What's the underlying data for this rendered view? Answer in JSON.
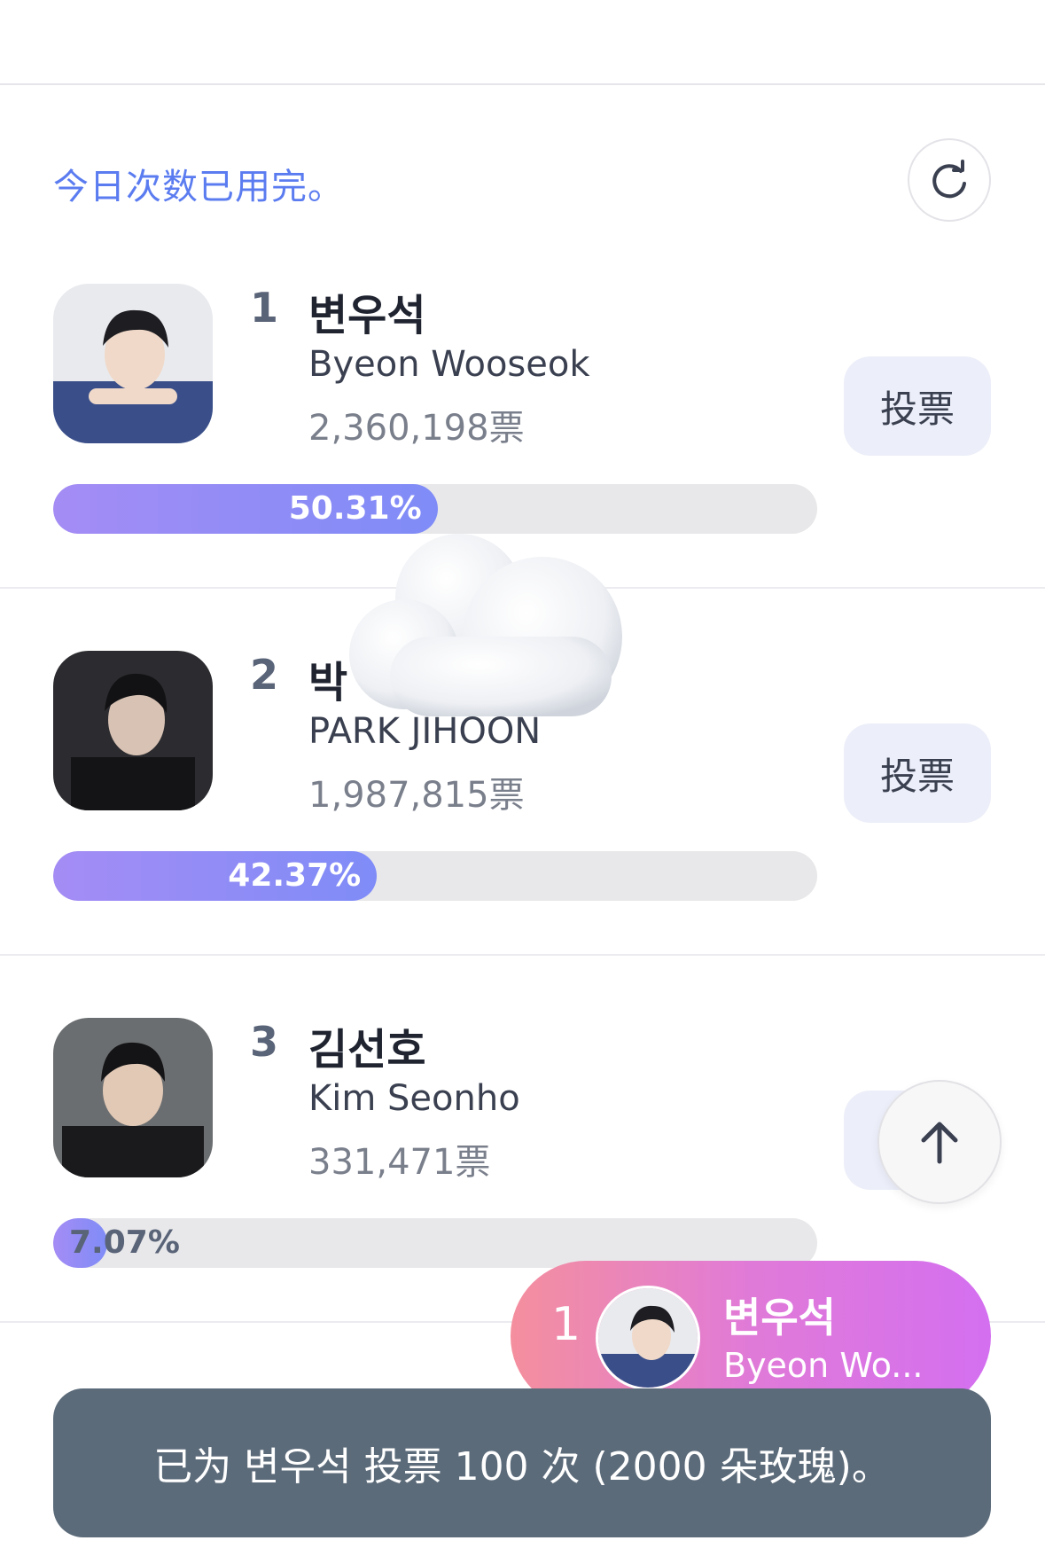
{
  "notice": "今日次数已用完。",
  "vote_label": "投票",
  "candidates": [
    {
      "rank": "1",
      "name_ko": "변우석",
      "name_en": "Byeon Wooseok",
      "votes": "2,360,198票",
      "pct_label": "50.31%",
      "pct": 50.31
    },
    {
      "rank": "2",
      "name_ko": "박",
      "name_en": "PARK JIHOON",
      "votes": "1,987,815票",
      "pct_label": "42.37%",
      "pct": 42.37
    },
    {
      "rank": "3",
      "name_ko": "김선호",
      "name_en": "Kim Seonho",
      "votes": "331,471票",
      "pct_label": "7.07%",
      "pct": 7.07
    }
  ],
  "leader": {
    "rank": "1",
    "name_ko": "변우석",
    "name_en": "Byeon Wo..."
  },
  "toast": "已为 변우석 投票 100 次 (2000 朵玫瑰)。",
  "icons": {
    "refresh": "refresh-icon",
    "scroll_top": "arrow-up-icon",
    "weather": "cloud-icon"
  },
  "colors": {
    "accent": "#5b7cf0",
    "bar_fill": "#8f8cf6",
    "toast_bg": "#5c6b7a",
    "leader_gradient_start": "#f48f9e",
    "leader_gradient_end": "#d46ff0"
  }
}
